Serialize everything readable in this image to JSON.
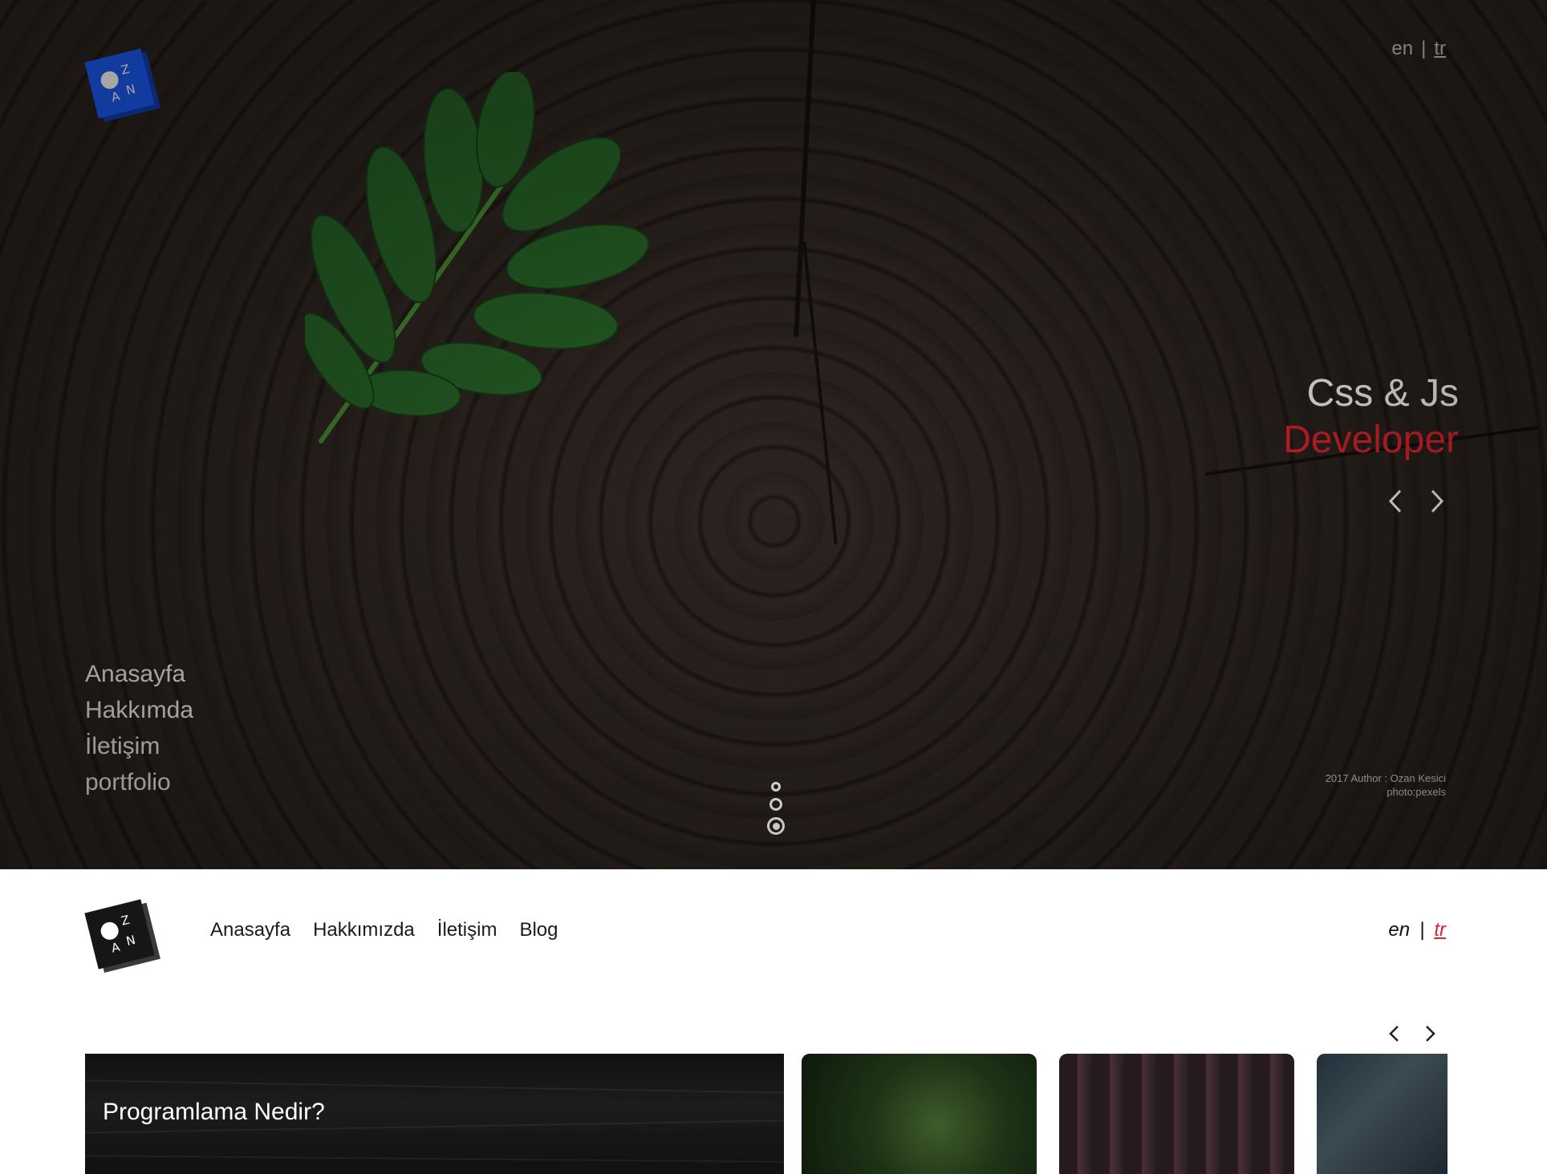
{
  "hero": {
    "lang": {
      "en": "en",
      "sep": "|",
      "tr": "tr"
    },
    "headline_line1": "Css & Js",
    "headline_line2": "Developer",
    "menu": [
      "Anasayfa",
      "Hakkımda",
      "İletişim",
      "portfolio"
    ],
    "credit_line1": "2017 Author : Ozan Kesici",
    "credit_line2": "photo:pexels",
    "slide_count": 3,
    "active_slide": 3
  },
  "logo": {
    "letters": [
      "Z",
      "A",
      "N"
    ]
  },
  "nav": {
    "links": [
      "Anasayfa",
      "Hakkımızda",
      "İletişim",
      "Blog"
    ],
    "lang": {
      "en": "en",
      "sep": "|",
      "tr": "tr"
    }
  },
  "cards": [
    {
      "title": "Programlama Nedir?"
    }
  ],
  "colors": {
    "accent_red": "#e0232d",
    "logo_blue": "#1a5bf2",
    "logo_dark": "#161616"
  }
}
